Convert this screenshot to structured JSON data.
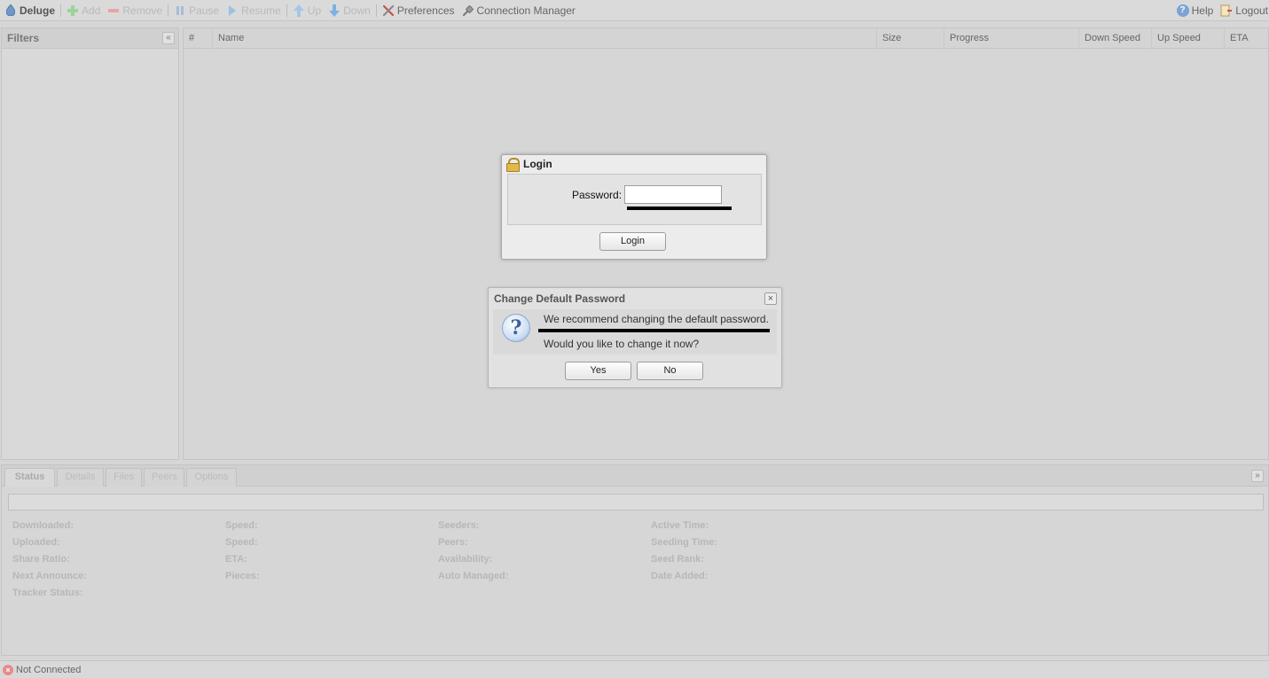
{
  "toolbar": {
    "brand": "Deluge",
    "add": "Add",
    "remove": "Remove",
    "pause": "Pause",
    "resume": "Resume",
    "up": "Up",
    "down": "Down",
    "preferences": "Preferences",
    "connection_manager": "Connection Manager",
    "help": "Help",
    "logout": "Logout"
  },
  "filters": {
    "title": "Filters",
    "collapse_glyph": "«"
  },
  "grid": {
    "columns": [
      "#",
      "Name",
      "Size",
      "Progress",
      "Down Speed",
      "Up Speed",
      "ETA"
    ]
  },
  "details": {
    "tabs": [
      "Status",
      "Details",
      "Files",
      "Peers",
      "Options"
    ],
    "active_tab": "Status",
    "expand_glyph": "»",
    "labels": {
      "col1": [
        "Downloaded:",
        "Uploaded:",
        "Share Ratio:",
        "Next Announce:",
        "Tracker Status:"
      ],
      "col2": [
        "Speed:",
        "Speed:",
        "ETA:",
        "Pieces:"
      ],
      "col3": [
        "Seeders:",
        "Peers:",
        "Availability:",
        "Auto Managed:"
      ],
      "col4": [
        "Active Time:",
        "Seeding Time:",
        "Seed Rank:",
        "Date Added:"
      ]
    }
  },
  "status_bar": {
    "text": "Not Connected"
  },
  "login_dialog": {
    "title": "Login",
    "password_label": "Password:",
    "password_value": "",
    "login_button": "Login"
  },
  "change_password_dialog": {
    "title": "Change Default Password",
    "close_glyph": "×",
    "message": "We recommend changing the default password.",
    "question": "Would you like to change it now?",
    "yes_button": "Yes",
    "no_button": "No"
  },
  "colors": {
    "background": "#d6d6d6",
    "dialog_bg": "#ececec",
    "redaction": "#000000"
  }
}
